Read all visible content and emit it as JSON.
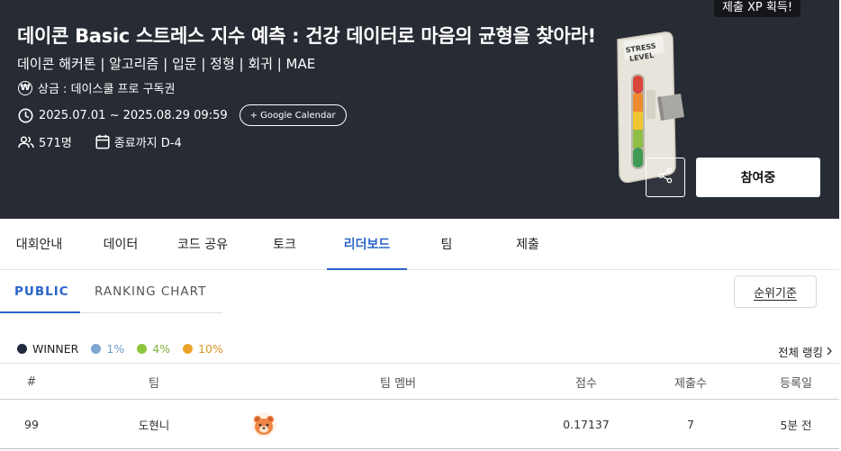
{
  "hero": {
    "title": "데이콘 Basic 스트레스 지수 예측 : 건강 데이터로 마음의 균형을 찾아라!",
    "meta": "데이콘 해커톤 | 알고리즘 | 입문 | 정형 | 회귀 | MAE",
    "prize_symbol": "₩",
    "prize": "상금 : 데이스쿨 프로 구독권",
    "period": "2025.07.01 ~ 2025.08.29 09:59",
    "calendar_button": "+ Google Calendar",
    "participants": "571명",
    "deadline": "종료까지 D-4",
    "xp_badge": "제출 XP 획득!",
    "join_button": "참여중",
    "illustration_text": "STRESS LEVEL"
  },
  "tabs": [
    {
      "label": "대회안내"
    },
    {
      "label": "데이터"
    },
    {
      "label": "코드 공유"
    },
    {
      "label": "토크"
    },
    {
      "label": "리더보드",
      "active": true
    },
    {
      "label": "팀"
    },
    {
      "label": "제출"
    }
  ],
  "subtabs": [
    {
      "label": "PUBLIC",
      "active": true
    },
    {
      "label": "RANKING CHART"
    }
  ],
  "criteria_button": "순위기준",
  "legend": [
    {
      "label": "WINNER",
      "color": "#1f2a3c"
    },
    {
      "label": "1%",
      "color": "#7ea6cf"
    },
    {
      "label": "4%",
      "color": "#8cc63e"
    },
    {
      "label": "10%",
      "color": "#eaa32a"
    }
  ],
  "all_ranking": "전체 랭킹",
  "table": {
    "headers": [
      "#",
      "팀",
      "팀 멤버",
      "점수",
      "제출수",
      "등록일"
    ],
    "rows": [
      {
        "rank": "99",
        "team": "도현니",
        "score": "0.17137",
        "submissions": "7",
        "date": "5분 전"
      }
    ]
  },
  "colors": {
    "hero_bg": "#272b33",
    "accent": "#2a64c8"
  }
}
